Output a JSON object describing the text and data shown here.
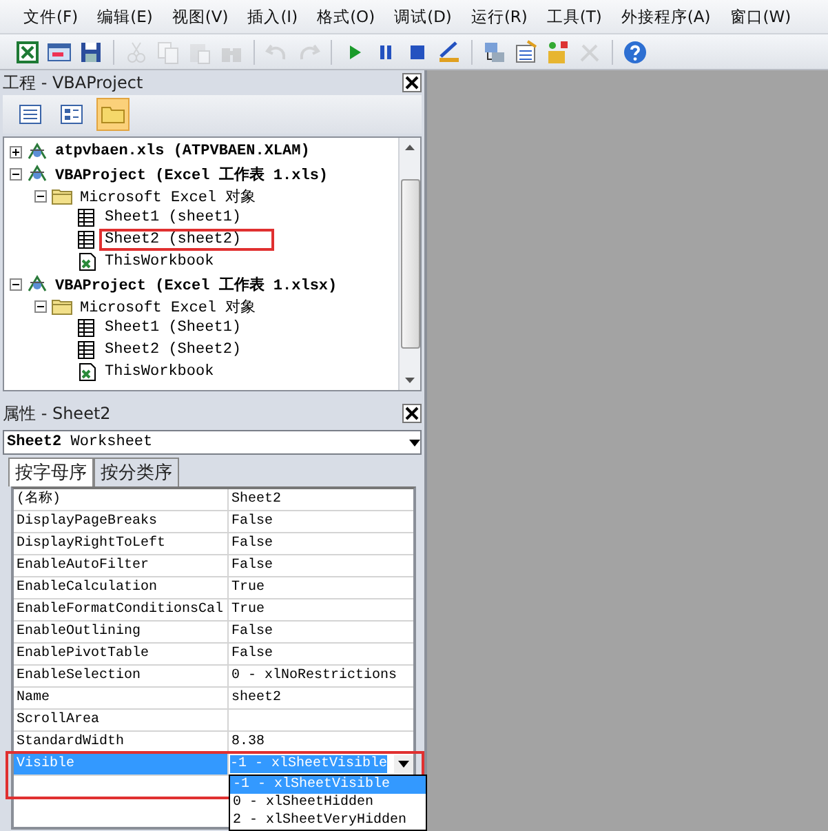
{
  "menu": [
    "文件(F)",
    "编辑(E)",
    "视图(V)",
    "插入(I)",
    "格式(O)",
    "调试(D)",
    "运行(R)",
    "工具(T)",
    "外接程序(A)",
    "窗口(W)"
  ],
  "toolbar": [
    {
      "kind": "excel",
      "disabled": false
    },
    {
      "kind": "userform",
      "disabled": false
    },
    {
      "kind": "save",
      "disabled": false
    },
    {
      "kind": "sep"
    },
    {
      "kind": "cut",
      "disabled": true
    },
    {
      "kind": "copy",
      "disabled": true
    },
    {
      "kind": "paste",
      "disabled": true
    },
    {
      "kind": "find",
      "disabled": true
    },
    {
      "kind": "sep"
    },
    {
      "kind": "undo",
      "disabled": true
    },
    {
      "kind": "redo",
      "disabled": true
    },
    {
      "kind": "sep"
    },
    {
      "kind": "run",
      "disabled": false
    },
    {
      "kind": "pause",
      "disabled": false
    },
    {
      "kind": "stop",
      "disabled": false
    },
    {
      "kind": "design",
      "disabled": false
    },
    {
      "kind": "sep"
    },
    {
      "kind": "explorer",
      "disabled": false
    },
    {
      "kind": "properties",
      "disabled": false
    },
    {
      "kind": "objects",
      "disabled": false
    },
    {
      "kind": "tools",
      "disabled": true
    },
    {
      "kind": "sep"
    },
    {
      "kind": "help",
      "disabled": false
    }
  ],
  "project": {
    "title": "工程 - VBAProject",
    "view_buttons": [
      {
        "kind": "code",
        "selected": false
      },
      {
        "kind": "object",
        "selected": false
      },
      {
        "kind": "folders",
        "selected": true
      }
    ],
    "tree": [
      {
        "kind": "project",
        "label": "atpvbaen.xls (ATPVBAEN.XLAM)",
        "expanded": false,
        "highlighted": false
      },
      {
        "kind": "project",
        "label": "VBAProject (Excel 工作表 1.xls)",
        "expanded": true,
        "highlighted": false,
        "children": [
          {
            "kind": "folder",
            "label": "Microsoft Excel 对象",
            "expanded": true,
            "highlighted": false,
            "children": [
              {
                "kind": "sheet",
                "label": "Sheet1 (sheet1)",
                "highlighted": false
              },
              {
                "kind": "sheet",
                "label": "Sheet2 (sheet2)",
                "highlighted": true
              },
              {
                "kind": "workbook",
                "label": "ThisWorkbook",
                "highlighted": false
              }
            ]
          }
        ]
      },
      {
        "kind": "project",
        "label": "VBAProject (Excel 工作表 1.xlsx)",
        "expanded": true,
        "highlighted": false,
        "children": [
          {
            "kind": "folder",
            "label": "Microsoft Excel 对象",
            "expanded": true,
            "highlighted": false,
            "children": [
              {
                "kind": "sheet",
                "label": "Sheet1 (Sheet1)",
                "highlighted": false
              },
              {
                "kind": "sheet",
                "label": "Sheet2 (Sheet2)",
                "highlighted": false
              },
              {
                "kind": "workbook",
                "label": "ThisWorkbook",
                "highlighted": false
              }
            ]
          }
        ]
      }
    ]
  },
  "properties": {
    "title": "属性 - Sheet2",
    "object_name": "Sheet2",
    "object_type": "Worksheet",
    "tabs": [
      {
        "label": "按字母序",
        "selected": true
      },
      {
        "label": "按分类序",
        "selected": false
      }
    ],
    "rows": [
      {
        "name": "(名称)",
        "value": "Sheet2",
        "selected": false,
        "highlighted": false
      },
      {
        "name": "DisplayPageBreaks",
        "value": "False",
        "selected": false,
        "highlighted": false
      },
      {
        "name": "DisplayRightToLeft",
        "value": "False",
        "selected": false,
        "highlighted": false
      },
      {
        "name": "EnableAutoFilter",
        "value": "False",
        "selected": false,
        "highlighted": false
      },
      {
        "name": "EnableCalculation",
        "value": "True",
        "selected": false,
        "highlighted": false
      },
      {
        "name": "EnableFormatConditionsCal",
        "value": "True",
        "selected": false,
        "highlighted": false
      },
      {
        "name": "EnableOutlining",
        "value": "False",
        "selected": false,
        "highlighted": false
      },
      {
        "name": "EnablePivotTable",
        "value": "False",
        "selected": false,
        "highlighted": false
      },
      {
        "name": "EnableSelection",
        "value": "0 - xlNoRestrictions",
        "selected": false,
        "highlighted": false
      },
      {
        "name": "Name",
        "value": "sheet2",
        "selected": false,
        "highlighted": false
      },
      {
        "name": "ScrollArea",
        "selected": false,
        "highlighted": false
      },
      {
        "name": "StandardWidth",
        "value": "8.38",
        "selected": false,
        "highlighted": false
      },
      {
        "name": "Visible",
        "value": "-1 - xlSheetVisible",
        "selected": true,
        "highlighted": true,
        "options": [
          {
            "label": "-1 - xlSheetVisible",
            "selected": true
          },
          {
            "label": "0 - xlSheetHidden",
            "selected": false
          },
          {
            "label": "2 - xlSheetVeryHidden",
            "selected": false
          }
        ]
      }
    ]
  }
}
